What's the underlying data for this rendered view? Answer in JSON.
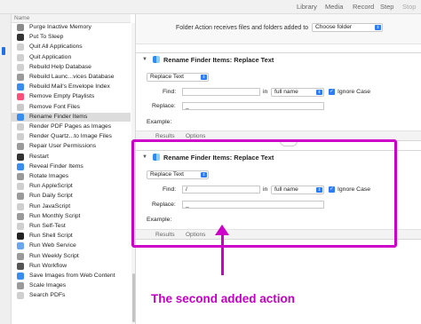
{
  "toolbar": {
    "library": "Library",
    "media": "Media",
    "record": "Record",
    "step": "Step",
    "stop": "Stop"
  },
  "list": {
    "header": "Name",
    "items": [
      {
        "label": "Purge Inactive Memory",
        "color": "#8a8a8a"
      },
      {
        "label": "Put To Sleep",
        "color": "#333333"
      },
      {
        "label": "Quit All Applications",
        "color": "#cfcfcf"
      },
      {
        "label": "Quit Application",
        "color": "#cfcfcf"
      },
      {
        "label": "Rebuild Help Database",
        "color": "#d0d0d0"
      },
      {
        "label": "Rebuild Launc...vices Database",
        "color": "#9a9a9a"
      },
      {
        "label": "Rebuild Mail's Envelope Index",
        "color": "#3a8df0"
      },
      {
        "label": "Remove Empty Playlists",
        "color": "#ff4f7a"
      },
      {
        "label": "Remove Font Files",
        "color": "#c9c9c9"
      },
      {
        "label": "Rename Finder Items",
        "color": "#3a8df0",
        "selected": true
      },
      {
        "label": "Render PDF Pages as Images",
        "color": "#cfcfcf"
      },
      {
        "label": "Render Quartz...to Image Files",
        "color": "#cfcfcf"
      },
      {
        "label": "Repair User Permissions",
        "color": "#9a9a9a"
      },
      {
        "label": "Restart",
        "color": "#333333"
      },
      {
        "label": "Reveal Finder Items",
        "color": "#3a8df0"
      },
      {
        "label": "Rotate Images",
        "color": "#9a9a9a"
      },
      {
        "label": "Run AppleScript",
        "color": "#cfcfcf"
      },
      {
        "label": "Run Daily Script",
        "color": "#9a9a9a"
      },
      {
        "label": "Run JavaScript",
        "color": "#cfcfcf"
      },
      {
        "label": "Run Monthly Script",
        "color": "#9a9a9a"
      },
      {
        "label": "Run Self-Test",
        "color": "#cfcfcf"
      },
      {
        "label": "Run Shell Script",
        "color": "#222222"
      },
      {
        "label": "Run Web Service",
        "color": "#6aa6f0"
      },
      {
        "label": "Run Weekly Script",
        "color": "#9a9a9a"
      },
      {
        "label": "Run Workflow",
        "color": "#555555"
      },
      {
        "label": "Save Images from Web Content",
        "color": "#3a8df0"
      },
      {
        "label": "Scale Images",
        "color": "#9a9a9a"
      },
      {
        "label": "Search PDFs",
        "color": "#cfcfcf"
      }
    ]
  },
  "workflow": {
    "folder_action_text": "Folder Action receives files and folders added to",
    "folder_choice": "Choose folder",
    "actions": [
      {
        "title": "Rename Finder Items: Replace Text",
        "mode": "Replace Text",
        "find_label": "Find:",
        "find_value": "",
        "in_label": "in",
        "in_choice": "full name",
        "ignore_case": "Ignore Case",
        "replace_label": "Replace:",
        "replace_value": "_",
        "example_label": "Example:",
        "tab_results": "Results",
        "tab_options": "Options"
      },
      {
        "title": "Rename Finder Items: Replace Text",
        "mode": "Replace Text",
        "find_label": "Find:",
        "find_value": "/",
        "in_label": "in",
        "in_choice": "full name",
        "ignore_case": "Ignore Case",
        "replace_label": "Replace:",
        "replace_value": "_",
        "example_label": "Example:",
        "tab_results": "Results",
        "tab_options": "Options"
      }
    ]
  },
  "annotation": {
    "caption": "The second added action",
    "color": "#cc00c8"
  }
}
